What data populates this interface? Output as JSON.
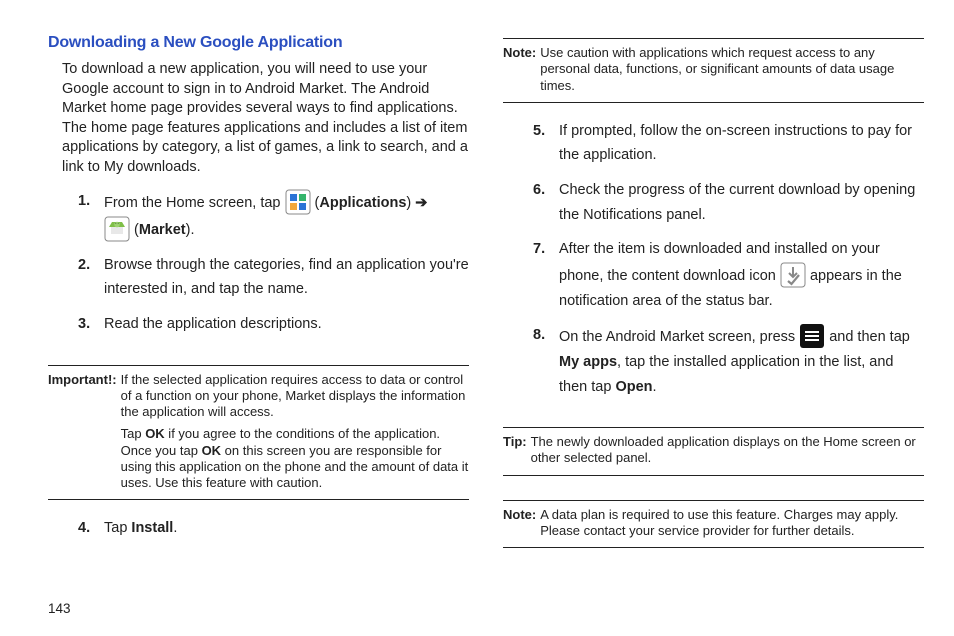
{
  "page_number": "143",
  "left": {
    "heading": "Downloading a New Google Application",
    "intro": "To download a new application, you will need to use your Google account to sign in to Android Market. The Android Market home page provides several ways to find applications. The home page features applications and includes a list of item applications by category, a list of games, a link to search, and a link to My downloads.",
    "steps": {
      "s1_num": "1.",
      "s1_a": "From the Home screen, tap ",
      "s1_apps_label": "Applications",
      "s1_arrow": "➔",
      "s1_market_label": "Market",
      "s2_num": "2.",
      "s2": "Browse through the categories, find an application you're interested in, and tap the name.",
      "s3_num": "3.",
      "s3": "Read the application descriptions.",
      "s4_num": "4.",
      "s4_a": "Tap ",
      "s4_b": "Install",
      "s4_c": "."
    },
    "important": {
      "label": "Important!:",
      "p1": "If the selected application requires access to data or control of a function on your phone, Market displays the information the application will access.",
      "p2_a": "Tap ",
      "p2_ok1": "OK",
      "p2_b": " if you agree to the conditions of the application. Once you tap ",
      "p2_ok2": "OK",
      "p2_c": " on this screen you are responsible for using this application on the phone and the amount of data it uses. Use this feature with caution."
    }
  },
  "right": {
    "note_top": {
      "label": "Note:",
      "text": "Use caution with applications which request access to any personal data, functions, or significant amounts of data usage times."
    },
    "steps": {
      "s5_num": "5.",
      "s5": "If prompted, follow the on-screen instructions to pay for the application.",
      "s6_num": "6.",
      "s6": "Check the progress of the current download by opening the Notifications panel.",
      "s7_num": "7.",
      "s7_a": "After the item is downloaded and installed on your phone, the content download icon ",
      "s7_b": " appears in the notification area of the status bar.",
      "s8_num": "8.",
      "s8_a": "On the Android Market screen, press ",
      "s8_b": " and then tap ",
      "s8_myapps": "My apps",
      "s8_c": ", tap the installed application in the list, and then tap ",
      "s8_open": "Open",
      "s8_d": "."
    },
    "tip": {
      "label": "Tip:",
      "text": "The newly downloaded application displays on the Home screen or other selected panel."
    },
    "note_bottom": {
      "label": "Note:",
      "text": " A data plan is required to use this feature. Charges may apply. Please contact your service provider for further details."
    }
  }
}
